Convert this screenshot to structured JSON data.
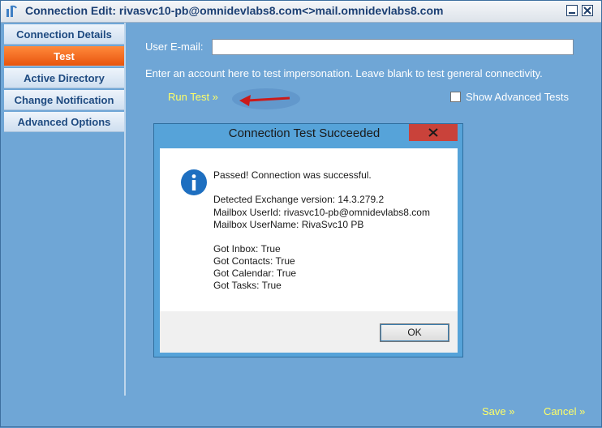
{
  "window": {
    "title": "Connection  Edit:  rivasvc10-pb@omnidevlabs8.com<>mail.omnidevlabs8.com",
    "minimize_icon": "minimize-icon",
    "close_icon": "close-icon"
  },
  "nav": {
    "items": [
      {
        "label": "Connection Details",
        "active": false
      },
      {
        "label": "Test",
        "active": true
      },
      {
        "label": "Active Directory",
        "active": false
      },
      {
        "label": "Change Notification",
        "active": false
      },
      {
        "label": "Advanced Options",
        "active": false
      }
    ]
  },
  "form": {
    "email_label": "User E-mail:",
    "email_value": "",
    "help_text": "Enter an account here to test impersonation. Leave blank to test general connectivity.",
    "run_test": "Run Test »",
    "show_advanced_label": "Show Advanced Tests",
    "show_advanced_checked": false,
    "save": "Save »",
    "cancel": "Cancel »"
  },
  "dialog": {
    "title": "Connection Test Succeeded",
    "icon": "info-icon",
    "lines": [
      "Passed! Connection was successful.",
      "Detected Exchange version: 14.3.279.2",
      "Mailbox UserId: rivasvc10-pb@omnidevlabs8.com",
      "Mailbox UserName: RivaSvc10 PB",
      "Got Inbox: True",
      "Got Contacts: True",
      "Got Calendar: True",
      "Got Tasks: True"
    ],
    "ok_label": "OK"
  },
  "colors": {
    "background": "#6fa6d6",
    "active_tab": "#e8540d",
    "link": "#ffff66",
    "dialog_frame": "#56a3d9",
    "dialog_close": "#c9423a"
  }
}
